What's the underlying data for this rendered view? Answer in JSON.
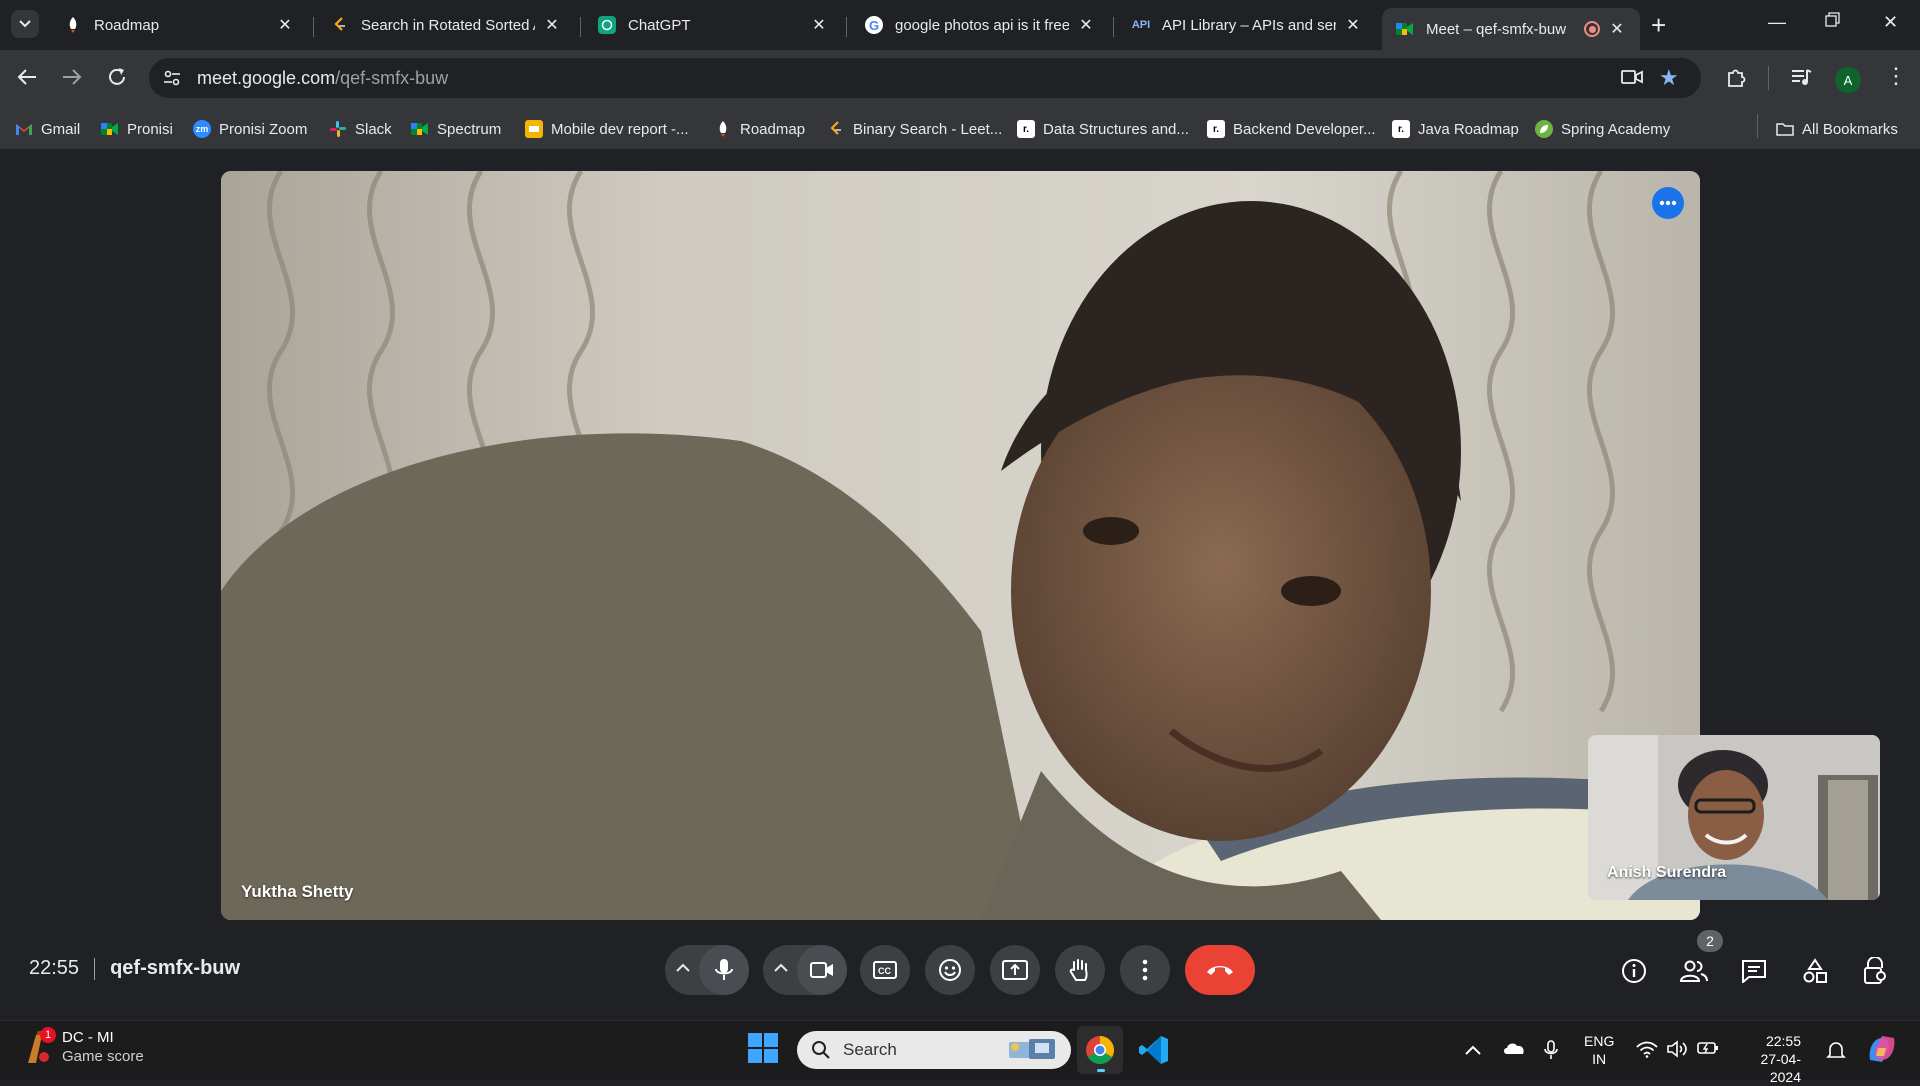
{
  "browser": {
    "tabs": [
      {
        "title": "Roadmap",
        "active": false
      },
      {
        "title": "Search in Rotated Sorted A",
        "active": false
      },
      {
        "title": "ChatGPT",
        "active": false
      },
      {
        "title": "google photos api is it free",
        "active": false
      },
      {
        "title": "API Library – APIs and serv",
        "active": false
      },
      {
        "title": "Meet – qef-smfx-buw",
        "active": true
      }
    ],
    "url_host": "meet.google.com",
    "url_path": "/qef-smfx-buw",
    "profile_initial": "A",
    "bookmarks": [
      {
        "label": "Gmail",
        "icon": "gmail-icon"
      },
      {
        "label": "Pronisi",
        "icon": "meet-icon"
      },
      {
        "label": "Pronisi Zoom",
        "icon": "zoom-icon"
      },
      {
        "label": "Slack",
        "icon": "slack-icon"
      },
      {
        "label": "Spectrum",
        "icon": "meet-icon"
      },
      {
        "label": "Mobile dev report -...",
        "icon": "slides-icon"
      },
      {
        "label": "Roadmap",
        "icon": "rocket-icon"
      },
      {
        "label": "Binary Search - Leet...",
        "icon": "leetcode-icon"
      },
      {
        "label": "Data Structures and...",
        "icon": "roadmap-icon"
      },
      {
        "label": "Backend Developer...",
        "icon": "roadmap-icon"
      },
      {
        "label": "Java Roadmap",
        "icon": "roadmap-icon"
      },
      {
        "label": "Spring Academy",
        "icon": "spring-icon"
      }
    ],
    "all_bookmarks_label": "All Bookmarks"
  },
  "meet": {
    "main_participant": "Yuktha Shetty",
    "pip_participant": "Anish Surendra",
    "time": "22:55",
    "meeting_code": "qef-smfx-buw",
    "participant_count": "2"
  },
  "taskbar": {
    "widget_title": "DC - MI",
    "widget_subtitle": "Game score",
    "widget_badge": "1",
    "search_placeholder": "Search",
    "lang_line1": "ENG",
    "lang_line2": "IN",
    "clock_time": "22:55",
    "clock_date": "27-04-2024"
  },
  "colors": {
    "end_call": "#ea4335",
    "meet_blue": "#1a73e8",
    "control_bg": "#3c4043"
  }
}
